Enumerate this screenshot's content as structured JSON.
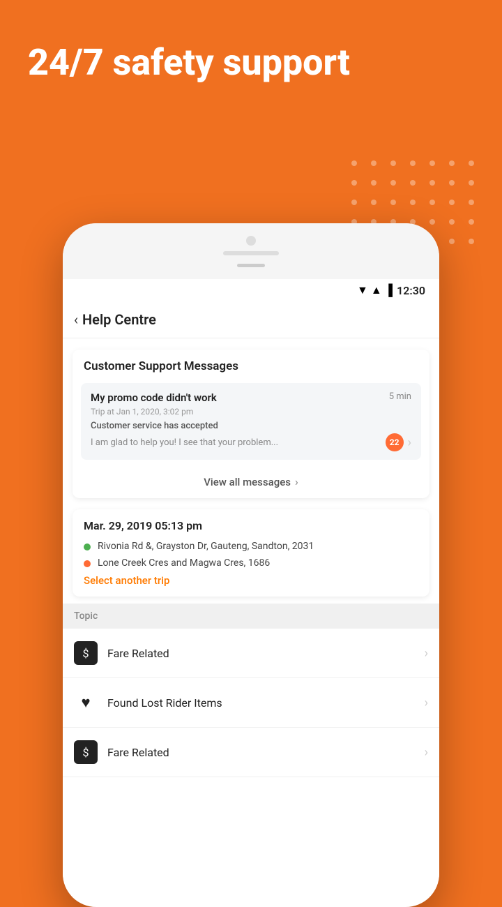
{
  "hero": {
    "title": "24/7 safety support"
  },
  "statusBar": {
    "time": "12:30",
    "wifiIcon": "▼",
    "signalIcon": "▲",
    "batteryIcon": "🔋"
  },
  "nav": {
    "backLabel": "‹",
    "title": "Help Centre"
  },
  "supportSection": {
    "header": "Customer Support Messages",
    "message": {
      "title": "My promo code didn't work",
      "time": "5 min",
      "trip": "Trip at Jan 1, 2020, 3:02 pm",
      "status": "Customer service has accepted",
      "preview": "I am glad to help you! I see that your problem...",
      "badgeCount": "22"
    },
    "viewAllLabel": "View all messages"
  },
  "tripSection": {
    "date": "Mar. 29, 2019  05:13 pm",
    "pickup": "Rivonia Rd &, Grayston Dr, Gauteng, Sandton, 2031",
    "dropoff": "Lone Creek Cres and Magwa Cres, 1686",
    "selectLabel": "Select another trip"
  },
  "topicSection": {
    "header": "Topic",
    "items": [
      {
        "id": "fare-related-1",
        "icon": "$",
        "iconType": "box",
        "label": "Fare Related"
      },
      {
        "id": "found-lost-rider-items",
        "icon": "♥",
        "iconType": "heart",
        "label": "Found Lost Rider Items"
      },
      {
        "id": "fare-related-2",
        "icon": "$",
        "iconType": "box",
        "label": "Fare Related"
      }
    ]
  }
}
